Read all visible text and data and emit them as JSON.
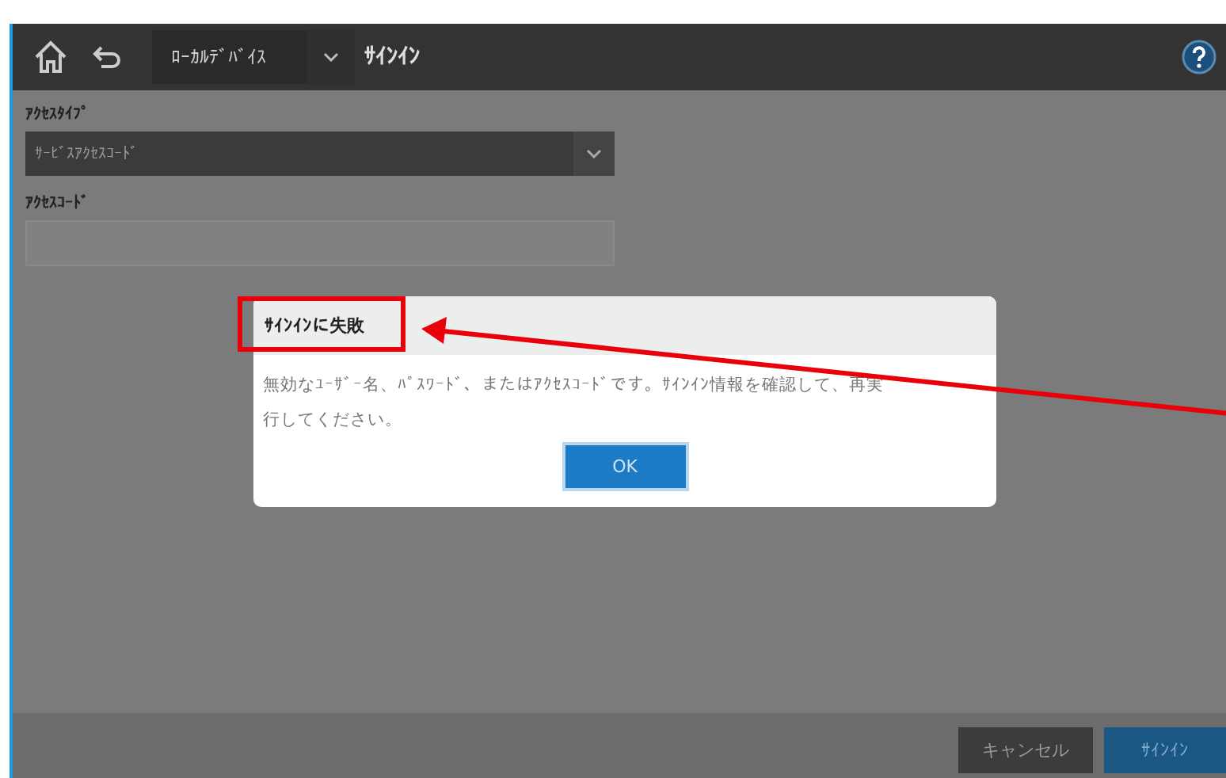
{
  "toolbar": {
    "device": "ﾛｰｶﾙﾃﾞﾊﾞｲｽ",
    "title": "ｻｲﾝｲﾝ"
  },
  "form": {
    "fields": [
      {
        "kind": "dropdown",
        "label": "ｱｸｾｽﾀｲﾌﾟ",
        "value": "ｻｰﾋﾞｽｱｸｾｽｺｰﾄﾞ"
      },
      {
        "kind": "text",
        "label": "ｱｸｾｽｺｰﾄﾞ"
      }
    ]
  },
  "dialog": {
    "title": "ｻｲﾝｲﾝに失敗",
    "message": "無効なﾕｰｻﾞｰ名、ﾊﾟｽﾜｰﾄﾞ、またはｱｸｾｽｺｰﾄﾞです。ｻｲﾝｲﾝ情報を確認して、再実行してください。",
    "button": "OK"
  },
  "footer": {
    "buttons": [
      {
        "kind": "secondary",
        "label": "キャンセル"
      },
      {
        "kind": "primary",
        "label": "ｻｲﾝｲﾝ"
      }
    ]
  },
  "annotation": {
    "kind": "callout"
  }
}
